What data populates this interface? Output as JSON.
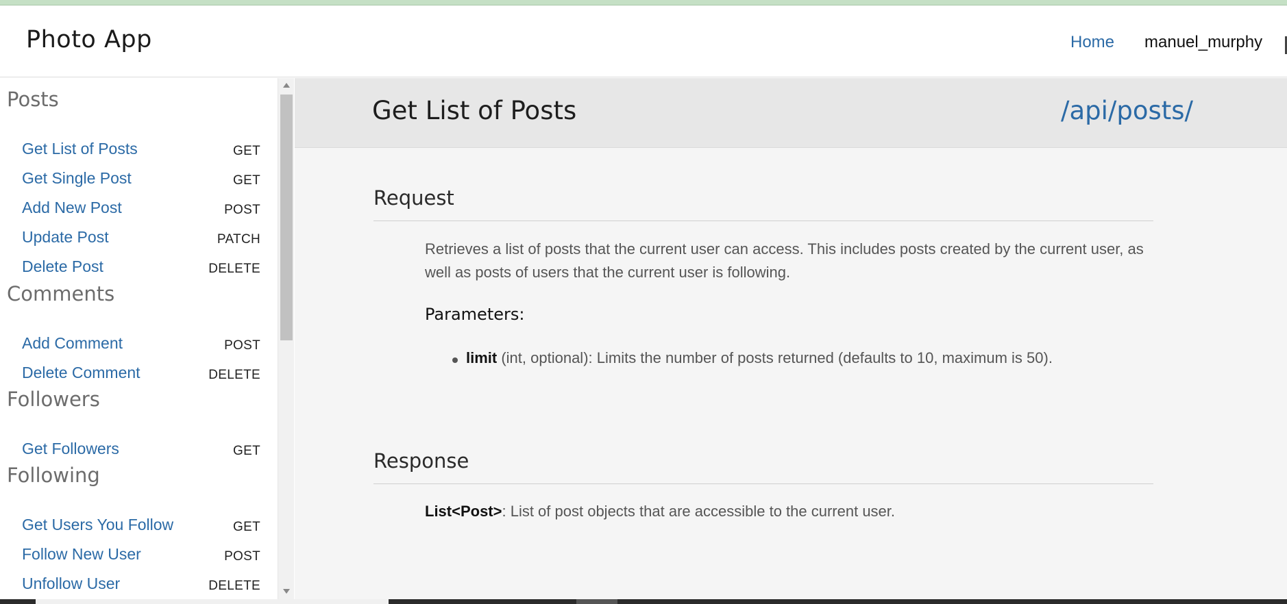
{
  "navbar": {
    "brand": "Photo App",
    "home_link": "Home",
    "username": "manuel_murphy"
  },
  "sidebar": {
    "sections": [
      {
        "title": "Posts",
        "items": [
          {
            "label": "Get List of Posts",
            "method": "GET"
          },
          {
            "label": "Get Single Post",
            "method": "GET"
          },
          {
            "label": "Add New Post",
            "method": "POST"
          },
          {
            "label": "Update Post",
            "method": "PATCH"
          },
          {
            "label": "Delete Post",
            "method": "DELETE"
          }
        ]
      },
      {
        "title": "Comments",
        "items": [
          {
            "label": "Add Comment",
            "method": "POST"
          },
          {
            "label": "Delete Comment",
            "method": "DELETE"
          }
        ]
      },
      {
        "title": "Followers",
        "items": [
          {
            "label": "Get Followers",
            "method": "GET"
          }
        ]
      },
      {
        "title": "Following",
        "items": [
          {
            "label": "Get Users You Follow",
            "method": "GET"
          },
          {
            "label": "Follow New User",
            "method": "POST"
          },
          {
            "label": "Unfollow User",
            "method": "DELETE"
          }
        ]
      }
    ]
  },
  "main": {
    "endpoint_title": "Get List of Posts",
    "endpoint_path": "/api/posts/",
    "request": {
      "heading": "Request",
      "description": "Retrieves a list of posts that the current user can access. This includes posts created by the current user, as well as posts of users that the current user is following.",
      "params_heading": "Parameters:",
      "params": [
        {
          "name": "limit",
          "desc": " (int, optional): Limits the number of posts returned (defaults to 10, maximum is 50)."
        }
      ]
    },
    "response": {
      "heading": "Response",
      "type": "List<Post>",
      "desc": ": List of post objects that are accessible to the current user."
    }
  },
  "colors": {
    "link": "#2b6aa6",
    "header_bg": "#e7e7e7",
    "content_bg": "#f5f5f5",
    "top_strip": "#c5e0c5"
  }
}
